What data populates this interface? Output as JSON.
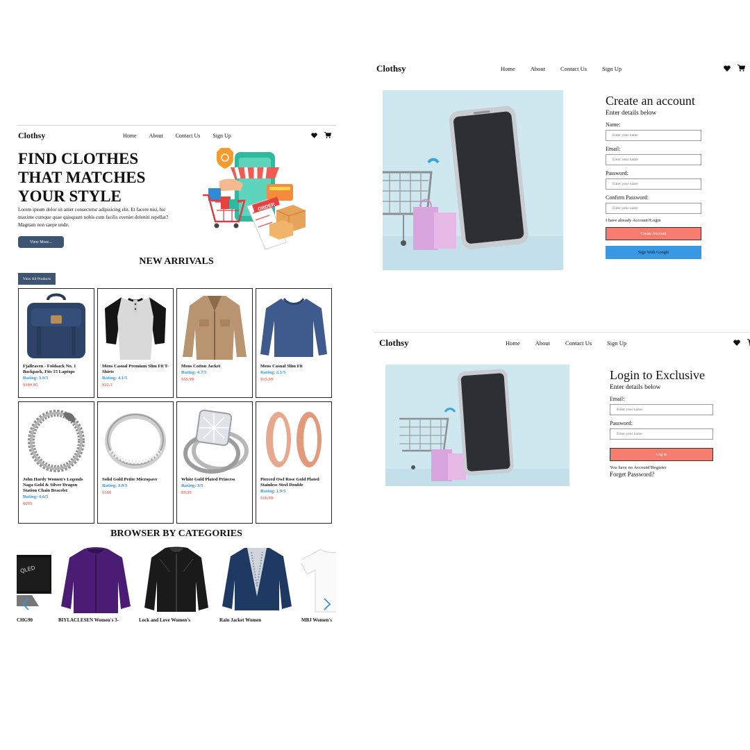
{
  "brand": "Clothsy",
  "nav_links": [
    "Home",
    "About",
    "Contact Us",
    "Sign Up"
  ],
  "home": {
    "hero": {
      "title": "FIND CLOTHES THAT MATCHES YOUR STYLE",
      "description": "Lorem ipsum dolor sit amet consectetur adipisicing elit. Et facere nisi, hic maxime cumque quae quisquam nobis cum facilis eveniet deleniti repellat? Magnam non saepe unde.",
      "button": "View More...",
      "art_badge": "ORDER"
    },
    "new_arrivals": {
      "title": "NEW ARRIVALS",
      "view_all": "View All Products",
      "rating_label": "Rating:",
      "products": [
        {
          "name": "Fjallraven - Foldsack No. 1 Backpack, Fits 15 Laptops",
          "rating": "3.9/5",
          "price": "$109.95",
          "icon": "backpack"
        },
        {
          "name": "Mens Casual Premium Slim Fit T-Shirts",
          "rating": "4.1/5",
          "price": "$22.3",
          "icon": "raglan-shirt"
        },
        {
          "name": "Mens Cotton Jacket",
          "rating": "4.7/5",
          "price": "$55.99",
          "icon": "jacket"
        },
        {
          "name": "Mens Casual Slim Fit",
          "rating": "2.1/5",
          "price": "$15.99",
          "icon": "long-sleeve-shirt"
        },
        {
          "name": "John Hardy Women's Legends Naga Gold & Silver Dragon Station Chain Bracelet",
          "rating": "4.6/5",
          "price": "$695",
          "icon": "bracelet"
        },
        {
          "name": "Solid Gold Petite Micropave",
          "rating": "3.9/5",
          "price": "$168",
          "icon": "silver-ring"
        },
        {
          "name": "White Gold Plated Princess",
          "rating": "3/5",
          "price": "$9.99",
          "icon": "princess-ring"
        },
        {
          "name": "Pierced Owl Rose Gold Plated Stainless Steel Double",
          "rating": "1.9/5",
          "price": "$10.99",
          "icon": "rose-gold-plugs"
        }
      ]
    },
    "categories": {
      "title": "BROWSER BY CATEGORIES",
      "items": [
        {
          "label": "CHG90",
          "icon": "gaming-monitor"
        },
        {
          "label": "BIYLACLESEN Women's 3-",
          "icon": "purple-jacket"
        },
        {
          "label": "Lock and Love Women's",
          "icon": "leather-jacket"
        },
        {
          "label": "Rain Jacket Women",
          "icon": "navy-jacket"
        },
        {
          "label": "MBJ Women's",
          "icon": "white-tee"
        }
      ]
    }
  },
  "signup": {
    "title": "Create an account",
    "subtitle": "Enter details below",
    "fields": [
      {
        "label": "Name:",
        "placeholder": "Enter your name"
      },
      {
        "label": "Email:",
        "placeholder": "Enter your name"
      },
      {
        "label": "Password:",
        "placeholder": "Enter your name"
      },
      {
        "label": "Confirm Password:",
        "placeholder": "Enter your name"
      }
    ],
    "login_link": "I have already Account?Login",
    "create_button": "Create Account",
    "google_button": "Sign With Google"
  },
  "login": {
    "title": "Login to Exclusive",
    "subtitle": "Enter details below",
    "fields": [
      {
        "label": "Email:",
        "placeholder": "Enter your name"
      },
      {
        "label": "Password:",
        "placeholder": "Enter your name"
      }
    ],
    "login_button": "Log in",
    "register_link": "You have no Account?Register",
    "forgot_link": "Forget Password?"
  },
  "colors": {
    "primary_button": "#3d5570",
    "accent_red": "#f67c6f",
    "accent_blue": "#3998e3",
    "photo_bg": "#cfe7ef"
  }
}
